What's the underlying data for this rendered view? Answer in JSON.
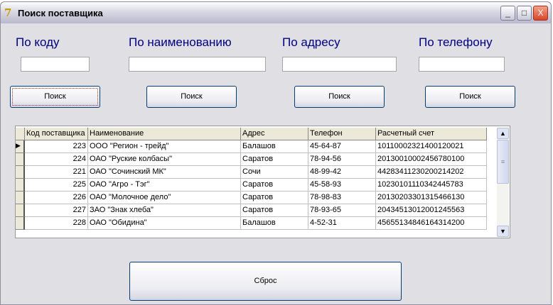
{
  "window": {
    "title": "Поиск поставщика",
    "minimize": "_",
    "maximize": "□",
    "close": "X"
  },
  "search": [
    {
      "label": "По коду",
      "value": "",
      "button": "Поиск"
    },
    {
      "label": "По наименованию",
      "value": "",
      "button": "Поиск"
    },
    {
      "label": "По адресу",
      "value": "",
      "button": "Поиск"
    },
    {
      "label": "По телефону",
      "value": "",
      "button": "Поиск"
    }
  ],
  "grid": {
    "columns": [
      "Код поставщика",
      "Наименование",
      "Адрес",
      "Телефон",
      "Расчетный счет"
    ],
    "rows": [
      [
        "223",
        "ООО \"Регион - трейд\"",
        "Балашов",
        "45-64-87",
        "10110002321400120021"
      ],
      [
        "224",
        "ОАО \"Руские колбасы\"",
        "Саратов",
        "78-94-56",
        "20130010002456780100"
      ],
      [
        "221",
        "ОАО \"Сочинский МК\"",
        "Сочи",
        "48-99-42",
        "44283411230200214202"
      ],
      [
        "225",
        "ОАО \"Агро - Тэг\"",
        "Саратов",
        "45-58-93",
        "10230101110342445783"
      ],
      [
        "226",
        "ОАО \"Молочное дело\"",
        "Саратов",
        "78-98-83",
        "20130203301315466130"
      ],
      [
        "227",
        "ЗАО \"Знак хлеба\"",
        "Саратов",
        "78-93-65",
        "20434513012001245563"
      ],
      [
        "228",
        "ОАО \"Обидина\"",
        "Балашов",
        "4-52-31",
        "45655134846164314200"
      ]
    ],
    "current_row_marker": "▶"
  },
  "reset_button": "Сброс"
}
